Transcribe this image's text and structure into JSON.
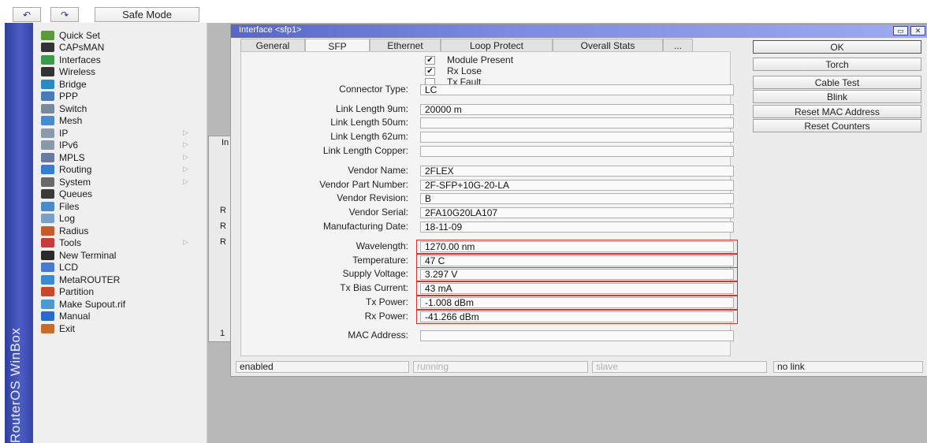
{
  "toolbar": {
    "undo": "↶",
    "redo": "↷",
    "safe_mode": "Safe Mode"
  },
  "brand": {
    "vertical_title": "RouterOS WinBox"
  },
  "menu": {
    "items": [
      {
        "label": "Quick Set",
        "icon": "quick-set-icon",
        "color": "#5b9a3c",
        "sub": false
      },
      {
        "label": "CAPsMAN",
        "icon": "capsman-icon",
        "color": "#333333",
        "sub": false
      },
      {
        "label": "Interfaces",
        "icon": "interfaces-icon",
        "color": "#3c9a4a",
        "sub": false
      },
      {
        "label": "Wireless",
        "icon": "wireless-icon",
        "color": "#333333",
        "sub": false
      },
      {
        "label": "Bridge",
        "icon": "bridge-icon",
        "color": "#2a8ac8",
        "sub": false
      },
      {
        "label": "PPP",
        "icon": "ppp-icon",
        "color": "#4a7ab8",
        "sub": false
      },
      {
        "label": "Switch",
        "icon": "switch-icon",
        "color": "#7a8a9a",
        "sub": false
      },
      {
        "label": "Mesh",
        "icon": "mesh-icon",
        "color": "#4a8ad0",
        "sub": false
      },
      {
        "label": "IP",
        "icon": "ip-icon",
        "color": "#8a9aa8",
        "sub": true
      },
      {
        "label": "IPv6",
        "icon": "ipv6-icon",
        "color": "#8a9aa8",
        "sub": true
      },
      {
        "label": "MPLS",
        "icon": "mpls-icon",
        "color": "#6a7aa0",
        "sub": true
      },
      {
        "label": "Routing",
        "icon": "routing-icon",
        "color": "#3a7ad0",
        "sub": true
      },
      {
        "label": "System",
        "icon": "system-icon",
        "color": "#6a6a6a",
        "sub": true
      },
      {
        "label": "Queues",
        "icon": "queues-icon",
        "color": "#3a3a3a",
        "sub": false
      },
      {
        "label": "Files",
        "icon": "files-icon",
        "color": "#4a8ac8",
        "sub": false
      },
      {
        "label": "Log",
        "icon": "log-icon",
        "color": "#7aa0c8",
        "sub": false
      },
      {
        "label": "Radius",
        "icon": "radius-icon",
        "color": "#c85a2a",
        "sub": false
      },
      {
        "label": "Tools",
        "icon": "tools-icon",
        "color": "#c83a3a",
        "sub": true
      },
      {
        "label": "New Terminal",
        "icon": "terminal-icon",
        "color": "#2a2a2a",
        "sub": false
      },
      {
        "label": "LCD",
        "icon": "lcd-icon",
        "color": "#4a7ad0",
        "sub": false
      },
      {
        "label": "MetaROUTER",
        "icon": "metarouter-icon",
        "color": "#3a8ad0",
        "sub": false
      },
      {
        "label": "Partition",
        "icon": "partition-icon",
        "color": "#c84a2a",
        "sub": false
      },
      {
        "label": "Make Supout.rif",
        "icon": "supout-icon",
        "color": "#4a9ad0",
        "sub": false
      },
      {
        "label": "Manual",
        "icon": "manual-icon",
        "color": "#2a6ad0",
        "sub": false
      },
      {
        "label": "Exit",
        "icon": "exit-icon",
        "color": "#c86a2a",
        "sub": false
      }
    ]
  },
  "bg_window": {
    "fragments": [
      "In",
      "R",
      "R",
      "R",
      "1"
    ]
  },
  "dialog": {
    "title": "Interface <sfp1>",
    "title_buttons": [
      "▭",
      "✕"
    ],
    "tabs": [
      "General",
      "SFP",
      "Ethernet",
      "Loop Protect",
      "Overall Stats",
      "..."
    ],
    "active_tab": "SFP",
    "checkboxes": [
      {
        "label": "Module Present",
        "checked": "✔"
      },
      {
        "label": "Rx Lose",
        "checked": "✔"
      },
      {
        "label": "Tx Fault",
        "checked": ""
      }
    ],
    "fields": [
      {
        "label": "Connector Type:",
        "value": "LC",
        "highlight": false
      },
      {
        "label": "Link Length 9um:",
        "value": "20000 m",
        "highlight": false
      },
      {
        "label": "Link Length 50um:",
        "value": "",
        "highlight": false
      },
      {
        "label": "Link Length 62um:",
        "value": "",
        "highlight": false
      },
      {
        "label": "Link Length Copper:",
        "value": "",
        "highlight": false
      },
      {
        "label": "Vendor Name:",
        "value": "2FLEX",
        "highlight": false
      },
      {
        "label": "Vendor Part Number:",
        "value": "2F-SFP+10G-20-LA",
        "highlight": false
      },
      {
        "label": "Vendor Revision:",
        "value": "B",
        "highlight": false
      },
      {
        "label": "Vendor Serial:",
        "value": "2FA10G20LA107",
        "highlight": false
      },
      {
        "label": "Manufacturing Date:",
        "value": "18-11-09",
        "highlight": false
      },
      {
        "label": "Wavelength:",
        "value": "1270.00 nm",
        "highlight": true
      },
      {
        "label": "Temperature:",
        "value": "47 C",
        "highlight": true
      },
      {
        "label": "Supply Voltage:",
        "value": "3.297 V",
        "highlight": true
      },
      {
        "label": "Tx Bias Current:",
        "value": "43 mA",
        "highlight": true
      },
      {
        "label": "Tx Power:",
        "value": "-1.008 dBm",
        "highlight": true
      },
      {
        "label": "Rx Power:",
        "value": "-41.266 dBm",
        "highlight": true
      },
      {
        "label": "MAC Address:",
        "value": "",
        "highlight": false
      }
    ],
    "buttons": [
      "OK",
      "Torch",
      "Cable Test",
      "Blink",
      "Reset MAC Address",
      "Reset Counters"
    ],
    "status": [
      "enabled",
      "running",
      "slave",
      "no link"
    ]
  },
  "colors": {
    "highlight": "#d8332e",
    "titlebar": "#6a78d6",
    "sidebar": "#3d4fb4"
  }
}
